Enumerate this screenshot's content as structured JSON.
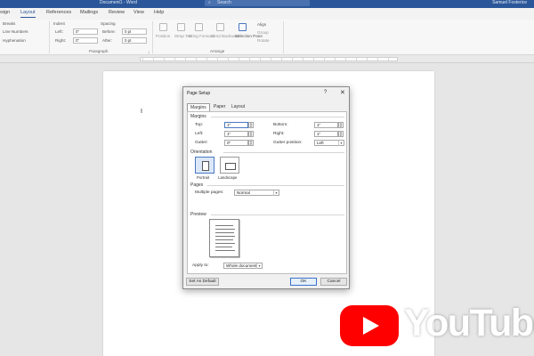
{
  "titlebar": {
    "document_title": "Document1 - Word",
    "search_placeholder": "Search",
    "user": "Samuel Fosterice"
  },
  "tabs": [
    "esign",
    "Layout",
    "References",
    "Mailings",
    "Review",
    "View",
    "Help"
  ],
  "ribbon": {
    "breaks": "Breaks",
    "line_numbers": "Line Numbers",
    "hyphenation": "Hyphenation",
    "indent_label": "Indent",
    "indent_left_label": "Left:",
    "indent_left_value": "0\"",
    "indent_right_label": "Right:",
    "indent_right_value": "0\"",
    "spacing_label": "Spacing",
    "before_label": "Before:",
    "before_value": "0 pt",
    "after_label": "After:",
    "after_value": "0 pt",
    "paragraph_group": "Paragraph",
    "position": "Position",
    "wrap_text": "Wrap Text",
    "bring_forward": "Bring Forward",
    "send_backward": "Send Backward",
    "selection_pane": "Selection Pane",
    "align": "Align",
    "group": "Group",
    "rotate": "Rotate",
    "arrange_group": "Arrange"
  },
  "dialog": {
    "title": "Page Setup",
    "help": "?",
    "close": "✕",
    "tabs": [
      "Margins",
      "Paper",
      "Layout"
    ],
    "margins_section": "Margins",
    "top_label": "Top:",
    "top_value": "1\"",
    "bottom_label": "Bottom:",
    "bottom_value": "1\"",
    "left_label": "Left:",
    "left_value": "1\"",
    "right_label": "Right:",
    "right_value": "1\"",
    "gutter_label": "Gutter:",
    "gutter_value": "0\"",
    "gutter_position_label": "Gutter position:",
    "gutter_position_value": "Left",
    "orientation_section": "Orientation",
    "portrait": "Portrait",
    "landscape": "Landscape",
    "pages_section": "Pages",
    "multiple_pages_label": "Multiple pages:",
    "multiple_pages_value": "Normal",
    "preview_section": "Preview",
    "apply_to_label": "Apply to:",
    "apply_to_value": "Whole document",
    "set_default": "Set As Default",
    "ok": "OK",
    "cancel": "Cancel"
  },
  "watermark": {
    "brand": "YouTube"
  },
  "colors": {
    "accent": "#2b579a",
    "youtube_red": "#ff0000"
  }
}
